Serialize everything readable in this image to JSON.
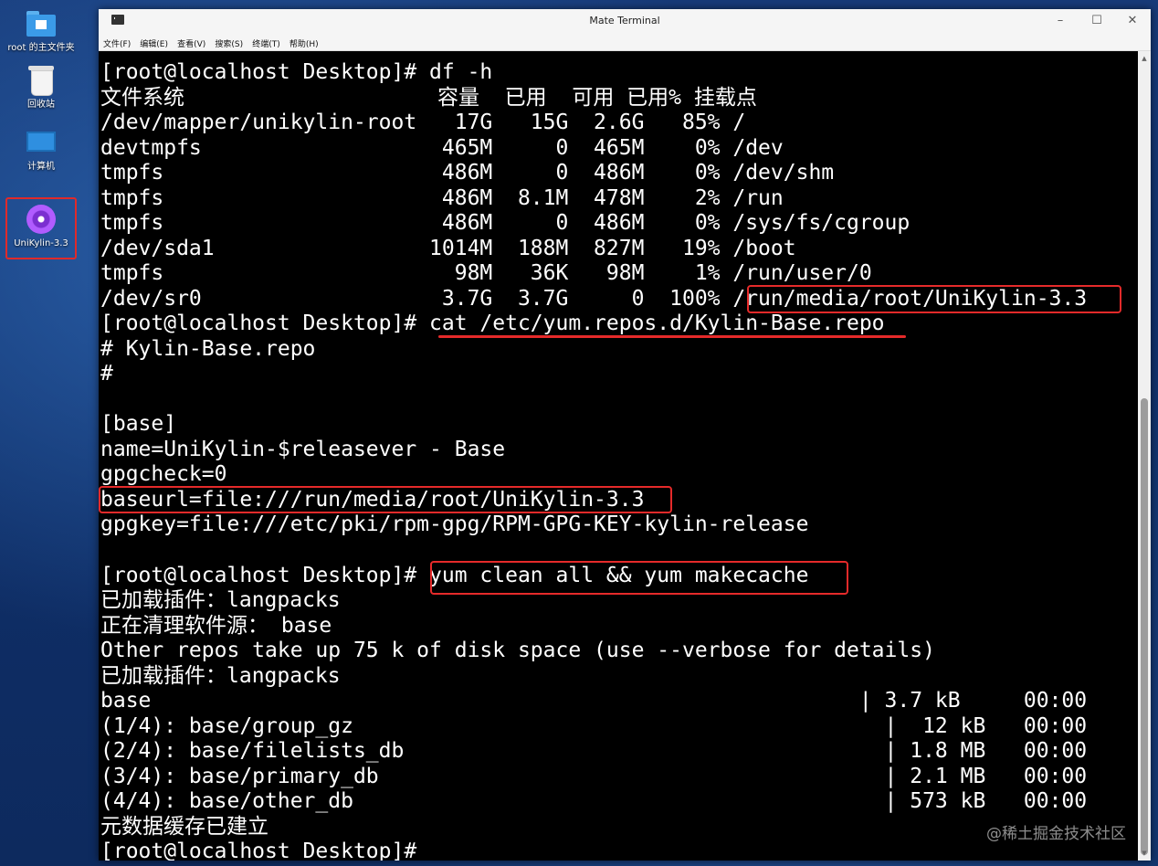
{
  "desktop": {
    "icons": [
      {
        "label": "root 的主文件夹",
        "icon": "home-folder-icon"
      },
      {
        "label": "回收站",
        "icon": "trash-icon"
      },
      {
        "label": "计算机",
        "icon": "computer-icon"
      },
      {
        "label": "UniKylin-3.3",
        "icon": "optical-disc-icon"
      }
    ]
  },
  "window": {
    "title": "Mate Terminal",
    "controls": {
      "minimize": "–",
      "maximize": "☐",
      "close": "✕"
    }
  },
  "menu": [
    "文件(F)",
    "编辑(E)",
    "查看(V)",
    "搜索(S)",
    "终端(T)",
    "帮助(H)"
  ],
  "terminal": {
    "lines": [
      "[root@localhost Desktop]# df -h",
      "文件系统                    容量  已用  可用 已用% 挂载点",
      "/dev/mapper/unikylin-root   17G   15G  2.6G   85% /",
      "devtmpfs                   465M     0  465M    0% /dev",
      "tmpfs                      486M     0  486M    0% /dev/shm",
      "tmpfs                      486M  8.1M  478M    2% /run",
      "tmpfs                      486M     0  486M    0% /sys/fs/cgroup",
      "/dev/sda1                 1014M  188M  827M   19% /boot",
      "tmpfs                       98M   36K   98M    1% /run/user/0",
      "/dev/sr0                   3.7G  3.7G     0  100% /run/media/root/UniKylin-3.3",
      "[root@localhost Desktop]# cat /etc/yum.repos.d/Kylin-Base.repo",
      "# Kylin-Base.repo",
      "#",
      "",
      "[base]",
      "name=UniKylin-$releasever - Base",
      "gpgcheck=0",
      "baseurl=file:///run/media/root/UniKylin-3.3",
      "gpgkey=file:///etc/pki/rpm-gpg/RPM-GPG-KEY-kylin-release",
      "",
      "[root@localhost Desktop]# yum clean all && yum makecache",
      "已加载插件：langpacks",
      "正在清理软件源： base",
      "Other repos take up 75 k of disk space (use --verbose for details)",
      "已加载插件：langpacks",
      "base                                                        | 3.7 kB     00:00",
      "(1/4): base/group_gz                                          |  12 kB   00:00",
      "(2/4): base/filelists_db                                      | 1.8 MB   00:00",
      "(3/4): base/primary_db                                        | 2.1 MB   00:00",
      "(4/4): base/other_db                                          | 573 kB   00:00",
      "元数据缓存已建立",
      "[root@localhost Desktop]#"
    ]
  },
  "watermark": "@稀土掘金技术社区",
  "colors": {
    "highlight": "#e52a2a",
    "terminal_bg": "#000000",
    "terminal_fg": "#ffffff"
  }
}
